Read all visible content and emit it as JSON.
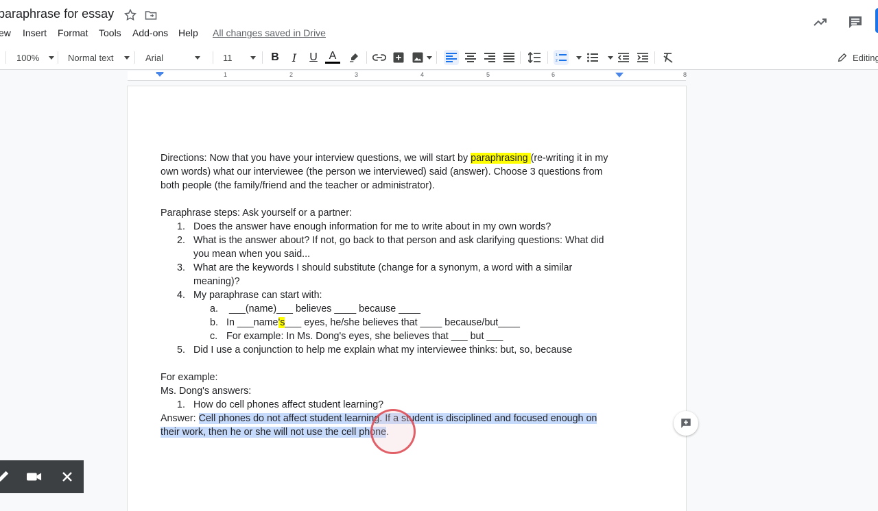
{
  "window": {
    "doc_title": "paraphrase for essay",
    "menu": [
      "ew",
      "Insert",
      "Format",
      "Tools",
      "Add-ons",
      "Help"
    ],
    "saved_status": "All changes saved in Drive"
  },
  "toolbar": {
    "zoom": "100%",
    "style": "Normal text",
    "font": "Arial",
    "font_size": "11",
    "bold": "B",
    "italic": "I",
    "underline": "U",
    "text_color": "A",
    "editing_mode": "Editing"
  },
  "ruler": {
    "marks": [
      "1",
      "2",
      "3",
      "4",
      "5",
      "6",
      "8"
    ]
  },
  "document": {
    "directions": {
      "pre": "Directions: Now that you have your interview questions, we will start by ",
      "highlight": "paraphrasing ",
      "post": "(re-writing it in my",
      "line2": "own words) what our interviewee (the person we interviewed) said (answer). Choose 3 questions from",
      "line3": "both people (the family/friend and the teacher or administrator)."
    },
    "steps_heading": "Paraphrase steps: Ask yourself or a partner:",
    "steps": [
      {
        "num": "1.",
        "lines": [
          "Does the answer have enough information for me to write about in my own words?"
        ]
      },
      {
        "num": "2.",
        "lines": [
          "What is the answer about? If not, go back to that person and ask clarifying questions: What did",
          "you mean when you said..."
        ]
      },
      {
        "num": "3.",
        "lines": [
          "What are the keywords I should substitute (change for a synonym, a word with a similar",
          "meaning)?"
        ]
      },
      {
        "num": "4.",
        "lines": [
          "My paraphrase can start with:"
        ]
      }
    ],
    "substeps": {
      "a_num": "a.",
      "a_text": "___(name)___ believes ____ because ____",
      "b_num": "b.",
      "b_pre": "In ___name",
      "b_hl": "'s",
      "b_post": "___ eyes, he/she believes that ____ because/but____",
      "c_num": "c.",
      "c_text": "For example: In Ms. Dong's eyes, she believes that ___ but ___"
    },
    "step5": {
      "num": "5.",
      "text": "Did I use a conjunction to help me explain what my interviewee thinks: but, so, because"
    },
    "for_example": "For example:",
    "answers_heading": "Ms. Dong's answers:",
    "question": {
      "num": "1.",
      "text": "How do cell phones affect student learning?"
    },
    "answer": {
      "label": "Answer: ",
      "line1": "Cell phones do not affect student learning. If a student is disciplined and focused enough on",
      "line2": "their work, then he or she will not use the cell phone",
      "line2_end": "."
    }
  },
  "colors": {
    "highlight": "#ffff00",
    "selection": "#c6dafc",
    "accent": "#1a73e8"
  }
}
